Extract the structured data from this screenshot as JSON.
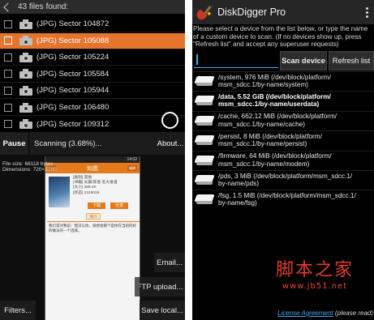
{
  "left": {
    "header": "43 files found:",
    "files": [
      {
        "name": "(JPG) Sector 104872",
        "selected": false
      },
      {
        "name": "(JPG) Sector 105088",
        "selected": true
      },
      {
        "name": "(JPG) Sector 105224",
        "selected": false
      },
      {
        "name": "(JPG) Sector 105584",
        "selected": false
      },
      {
        "name": "(JPG) Sector 105944",
        "selected": false
      },
      {
        "name": "(JPG) Sector 106480",
        "selected": false
      },
      {
        "name": "(JPG) Sector 109312",
        "selected": false
      }
    ],
    "pause_label": "Pause",
    "scan_status": "Scanning (3.68%)...",
    "scan_progress_percent": 3.68,
    "about_label": "About...",
    "file_size": "File size: 66118 bytes",
    "dimensions": "Dimensions: 720×1280",
    "preview": {
      "status_time": "14:02",
      "title": "如愿",
      "edit_label": "编辑",
      "meta_lines": [
        "[类别] 其他",
        "[书籍] 长篇/其他 名大发道",
        "[大小] 289.4K",
        "[状态] 1319015"
      ],
      "download_label": "下载",
      "share_label": "分享",
      "tab_label": "简介",
      "description": "我们常对我说：我没认你，很想会那个是你在当初的好的做法的一个选择。"
    },
    "email_label": "Email...",
    "ftp_label": "FTP upload...",
    "filters_label": "Filters...",
    "save_label": "Save local..."
  },
  "right": {
    "app_title": "DiskDigger Pro",
    "instructions": "Please select a device from the list below, or type the name of a custom device to scan. (If no devices show up, press \"Refresh list\" and accept any superuser requests)",
    "device_input_value": "",
    "scan_device_label": "Scan device",
    "refresh_label": "Refresh list",
    "devices": [
      {
        "line1": "/system, 976 MiB (/dev/block/platform/",
        "line2": "msm_sdcc.1/by-name/system)",
        "bold": false
      },
      {
        "line1": "/data, 5.52 GiB (/dev/block/platform/",
        "line2": "msm_sdcc.1/by-name/userdata)",
        "bold": true
      },
      {
        "line1": "/cache, 662.12 MiB (/dev/block/platform/",
        "line2": "msm_sdcc.1/by-name/cache)",
        "bold": false
      },
      {
        "line1": "/persist, 8 MiB (/dev/block/platform/",
        "line2": "msm_sdcc.1/by-name/persist)",
        "bold": false
      },
      {
        "line1": "/firmware, 64 MiB (/dev/block/platform/",
        "line2": "msm_sdcc.1/by-name/modem)",
        "bold": false
      },
      {
        "line1": "/pds, 3 MiB (/dev/block/platform/msm_sdcc.1/",
        "line2": "by-name/pds)",
        "bold": false
      },
      {
        "line1": "/fsg, 1.5 MiB (/dev/block/platform/msm_sdcc.1/",
        "line2": "by-name/fsg)",
        "bold": false
      }
    ],
    "watermark_text": "脚本之家",
    "watermark_url": "www.jb51.net",
    "license_link": "License Agreement",
    "license_note": "(please read)"
  },
  "colors": {
    "selected_row": "#e5752d",
    "input_accent": "#3ab0e8",
    "watermark": "#e33a2b",
    "license_link": "#4aa3e6"
  }
}
